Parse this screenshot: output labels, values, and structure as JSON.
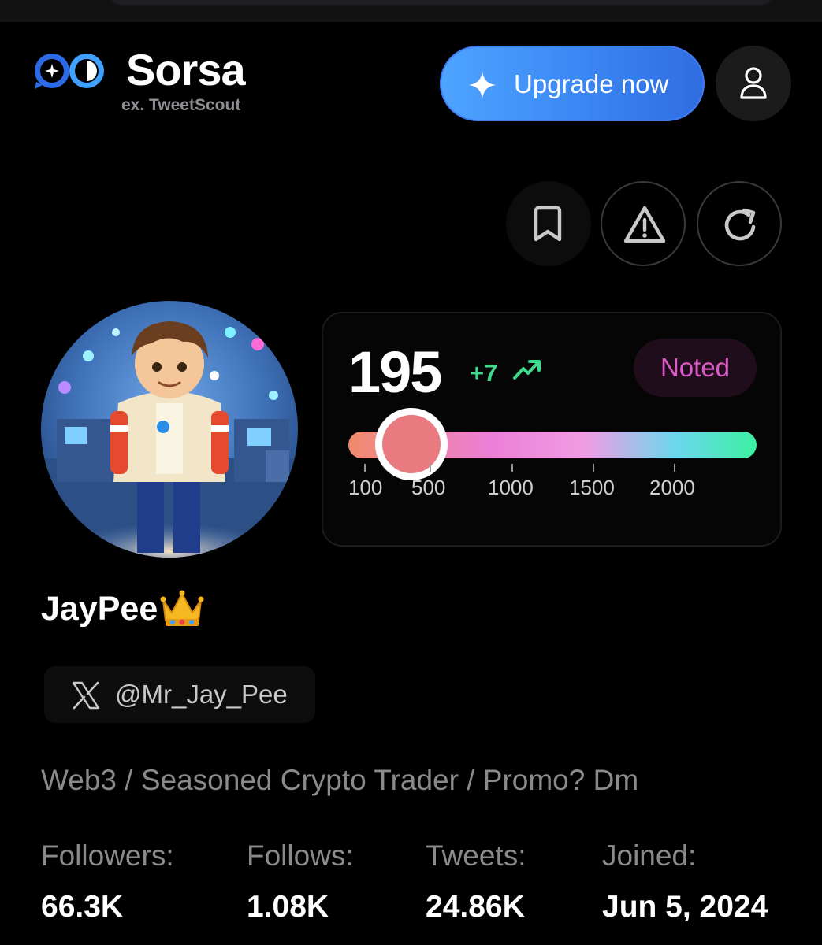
{
  "brand": {
    "name": "Sorsa",
    "subtitle": "ex. TweetScout"
  },
  "header": {
    "upgrade_label": "Upgrade now",
    "user_icon": "user-icon",
    "accent_blue": "#3b86f3"
  },
  "actions": [
    {
      "icon": "bookmark-icon"
    },
    {
      "icon": "warning-icon"
    },
    {
      "icon": "refresh-icon"
    }
  ],
  "score": {
    "value": "195",
    "delta": "+7",
    "trend_icon": "trend-up-icon",
    "badge": "Noted",
    "badge_color": "#dc5bc8",
    "delta_color": "#3fd98c",
    "slider": {
      "value": 195,
      "ticks": [
        "100",
        "500",
        "1000",
        "1500",
        "2000"
      ]
    }
  },
  "profile": {
    "display_name": "JayPee",
    "name_emoji": "crown-icon",
    "platform_icon": "x-logo-icon",
    "handle": "@Mr_Jay_Pee",
    "bio": "Web3 / Seasoned Crypto Trader / Promo? Dm"
  },
  "stats": [
    {
      "label": "Followers:",
      "value": "66.3K"
    },
    {
      "label": "Follows:",
      "value": "1.08K"
    },
    {
      "label": "Tweets:",
      "value": "24.86K"
    },
    {
      "label": "Joined:",
      "value": "Jun 5, 2024"
    }
  ]
}
